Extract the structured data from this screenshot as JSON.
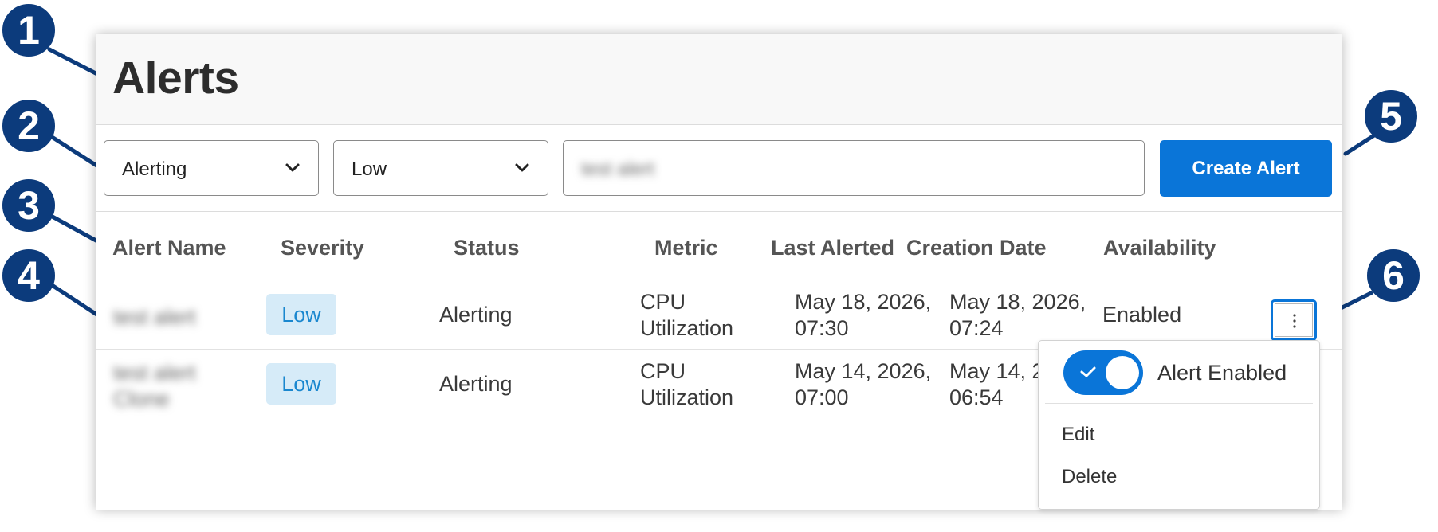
{
  "page": {
    "title": "Alerts"
  },
  "filters": {
    "status_value": "Alerting",
    "severity_value": "Low",
    "search_value": "test alert",
    "create_button": "Create Alert"
  },
  "table": {
    "headers": {
      "name": "Alert Name",
      "severity": "Severity",
      "status": "Status",
      "metric": "Metric",
      "last_alerted": "Last Alerted",
      "creation_date": "Creation Date",
      "availability": "Availability"
    },
    "rows": [
      {
        "name": "test alert",
        "severity": "Low",
        "status": "Alerting",
        "metric_line1": "CPU",
        "metric_line2": "Utilization",
        "last_alerted_line1": "May 18, 2026,",
        "last_alerted_line2": "07:30",
        "creation_line1": "May 18, 2026,",
        "creation_line2": "07:24",
        "availability": "Enabled"
      },
      {
        "name_line1": "test alert",
        "name_line2": "Clone",
        "severity": "Low",
        "status": "Alerting",
        "metric_line1": "CPU",
        "metric_line2": "Utilization",
        "last_alerted_line1": "May 14, 2026,",
        "last_alerted_line2": "07:00",
        "creation_line1": "May 14, 2",
        "creation_line2": "06:54"
      }
    ]
  },
  "row_menu": {
    "toggle_label": "Alert Enabled",
    "toggle_on": true,
    "edit": "Edit",
    "delete": "Delete"
  },
  "callouts": [
    "1",
    "2",
    "3",
    "4",
    "5",
    "6"
  ],
  "colors": {
    "primary": "#0a75d8",
    "callout": "#0c3b7c",
    "severity_badge_bg": "#d6ebf8",
    "severity_badge_text": "#1a87cf"
  },
  "icons": {
    "dropdown": "chevron-down-icon",
    "more": "more-vertical-icon",
    "toggle_check": "check-icon"
  }
}
